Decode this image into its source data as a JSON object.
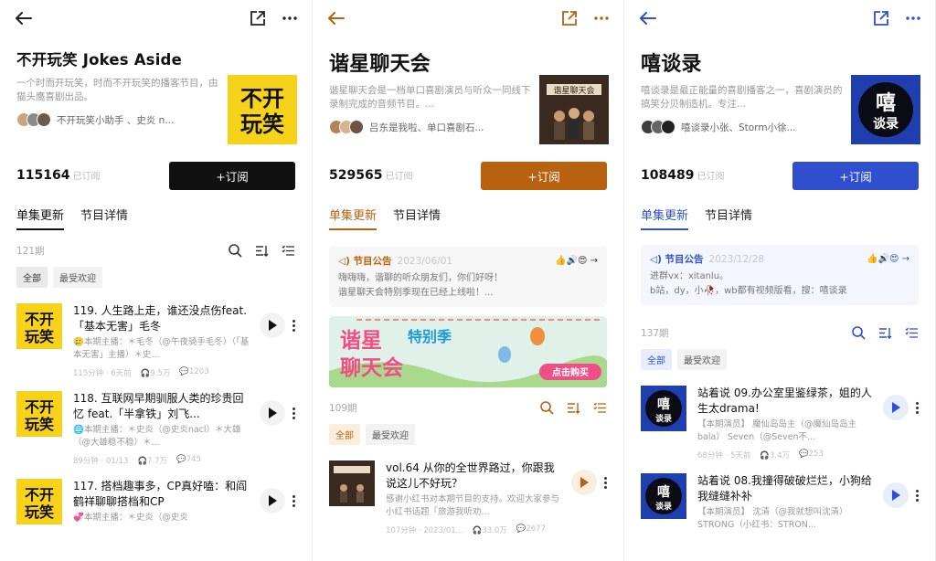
{
  "panels": [
    {
      "title": "不开玩笑 Jokes Aside",
      "description": "一个时而开玩笑，时而不开玩笑的播客节目，由猫头鹰喜剧出品。",
      "hosts": "不开玩笑小助手 、史炎 n...",
      "subscribers": "115164",
      "subscribers_unit": "已订阅",
      "subscribe_label": "+订阅",
      "tab1": "单集更新",
      "tab2": "节目详情",
      "episode_count": "121期",
      "filter_all": "全部",
      "filter_popular": "最受欢迎",
      "accent": "#111111",
      "episodes": [
        {
          "title": "119. 人生路上走，谁还没点伤feat.「基本无害」毛冬",
          "hosts": "🥲本期主播：＊毛冬（@午夜骑手毛冬）（「基本无害」主播）＊史...",
          "duration": "115分钟",
          "date": "6天前",
          "plays": "9.5万",
          "comments": "1203"
        },
        {
          "title": "118. 互联网早期驯服人类的珍贵回忆 feat.「半拿铁」刘飞...",
          "hosts": "🌐本期主播：＊史炎（@史炎nacl）＊大雄（@大雄稳不稳）＊...",
          "duration": "89分钟",
          "date": "01/13",
          "plays": "7.7万",
          "comments": "745"
        },
        {
          "title": "117. 搭档趣事多，CP真好嗑：和阎鹤祥聊聊搭档和CP",
          "hosts": "💞本期主播：＊史炎（@史炎",
          "duration": "",
          "date": "",
          "plays": "",
          "comments": ""
        }
      ]
    },
    {
      "title": "谐星聊天会",
      "description": "谐星聊天会是一档单口喜剧演员与听众一同线下录制完成的音频节目。...",
      "hosts": "吕东是我啦、单口喜剧石...",
      "subscribers": "529565",
      "subscribers_unit": "已订阅",
      "subscribe_label": "+订阅",
      "tab1": "单集更新",
      "tab2": "节目详情",
      "notice_label": "◁) 节目公告",
      "notice_date": "2023/06/01",
      "notice_text1": "嗨嗨嗨，谐聊的听众朋友们，你们好呀！",
      "notice_text2": "谐星聊天会特别季现在已经上线啦！...",
      "banner_title": "谐星 聊天会",
      "banner_sub": "特别季",
      "banner_button": "点击购买",
      "episode_count": "109期",
      "filter_all": "全部",
      "filter_popular": "最受欢迎",
      "accent": "#b8620f",
      "cover_text": "谐星聊天会",
      "episodes": [
        {
          "title": "vol.64 从你的全世界路过，你跟我说这儿不好玩？",
          "hosts": "感谢小红书对本期节目的支持。欢迎大家参与小红书话题「旅游我听劝...",
          "duration": "107分钟",
          "date": "2023/01...",
          "plays": "33.0万",
          "comments": "2677"
        }
      ]
    },
    {
      "title": "嘻谈录",
      "description": "嘻谈录是最正能量的喜剧播客之一，喜剧演员的搞笑分贝制造机。专注...",
      "hosts": "嘻谈录小张、Storm小徐...",
      "subscribers": "108489",
      "subscribers_unit": "已订阅",
      "subscribe_label": "+订阅",
      "tab1": "单集更新",
      "tab2": "节目详情",
      "notice_label": "◁) 节目公告",
      "notice_date": "2023/12/28",
      "notice_text1": "进群vx：xitanlu。",
      "notice_text2": "b站，dy，小🥀，wb都有视频版看，搜：嘻谈录",
      "episode_count": "137期",
      "filter_all": "全部",
      "filter_popular": "最受欢迎",
      "accent": "#2f4fcf",
      "cover_top": "嘻",
      "cover_bottom": "谈录",
      "episodes": [
        {
          "title": "站着说 09.办公室里鉴绿茶，姐的人生太drama!",
          "hosts": "【本期演员】 魔仙岛岛主（@魔仙岛岛主 bala） Seven（@Seven不...",
          "duration": "68分钟",
          "date": "5天前",
          "plays": "3.4万",
          "comments": "253"
        },
        {
          "title": "站着说 08.我撞得破破烂烂，小狗给我缝缝补补",
          "hosts": "【本期演员】 沈清（@我就想叫沈清） STRONG（小红书：STRON...",
          "duration": "",
          "date": "",
          "plays": "",
          "comments": ""
        }
      ]
    }
  ]
}
